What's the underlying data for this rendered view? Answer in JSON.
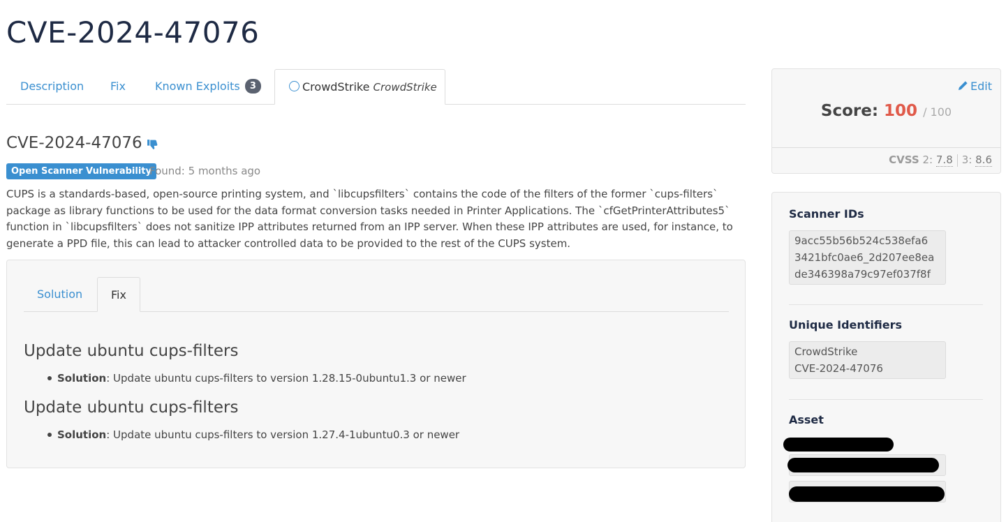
{
  "page": {
    "title": "CVE-2024-47076"
  },
  "tabs": [
    {
      "label": "Description"
    },
    {
      "label": "Fix"
    },
    {
      "label": "Known Exploits",
      "count": "3"
    },
    {
      "label": "CrowdStrike",
      "sublabel": "CrowdStrike",
      "icon": "circle-icon"
    }
  ],
  "vuln": {
    "heading": "CVE-2024-47076",
    "status_badge": "Open Scanner Vulnerability",
    "found": "Found: 5 months ago",
    "description": "CUPS is a standards-based, open-source printing system, and `libcupsfilters` contains the code of the filters of the former `cups-filters` package as library functions to be used for the data format conversion tasks needed in Printer Applications. The `cfGetPrinterAttributes5` function in `libcupsfilters` does not sanitize IPP attributes returned from an IPP server. When these IPP attributes are used, for instance, to generate a PPD file, this can lead to attacker controlled data to be provided to the rest of the CUPS system."
  },
  "fix_panel": {
    "tabs": [
      {
        "label": "Solution"
      },
      {
        "label": "Fix"
      }
    ],
    "items": [
      {
        "heading": "Update ubuntu cups-filters",
        "label": "Solution",
        "text": ": Update ubuntu cups-filters to version 1.28.15-0ubuntu1.3 or newer"
      },
      {
        "heading": "Update ubuntu cups-filters",
        "label": "Solution",
        "text": ": Update ubuntu cups-filters to version 1.27.4-1ubuntu0.3 or newer"
      }
    ]
  },
  "score": {
    "edit_label": "Edit",
    "label": "Score:",
    "value": "100",
    "max": "/ 100",
    "cvss_label": "CVSS",
    "cvss2_label": "2:",
    "cvss2_value": "7.8",
    "cvss3_label": "3:",
    "cvss3_value": "8.6"
  },
  "details": {
    "scanner_ids_heading": "Scanner IDs",
    "scanner_ids": [
      "9acc55b56b524c538efa6",
      "3421bfc0ae6_2d207ee8ea",
      "de346398a79c97ef037f8f"
    ],
    "unique_ids_heading": "Unique Identifiers",
    "unique_ids": [
      "CrowdStrike",
      "CVE-2024-47076"
    ],
    "asset_heading": "Asset"
  },
  "colors": {
    "accent": "#3a8fd0",
    "score_red": "#e05a4a",
    "title": "#1e2a44"
  }
}
